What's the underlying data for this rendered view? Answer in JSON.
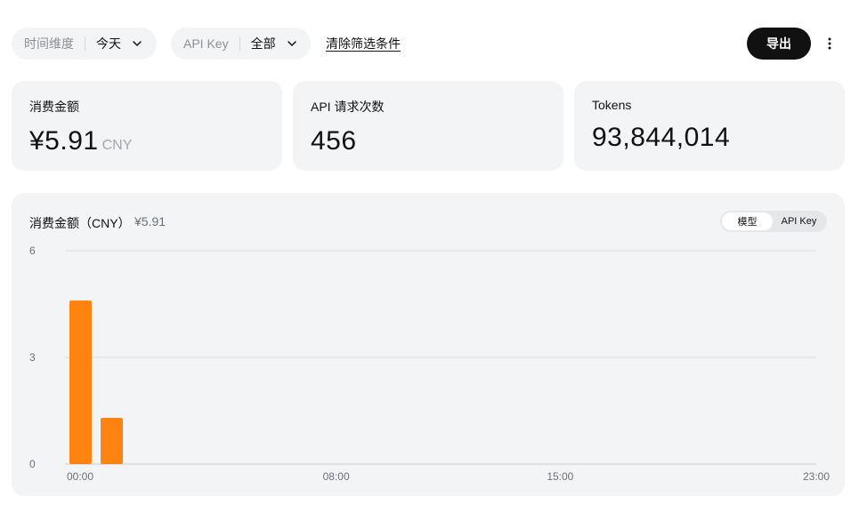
{
  "filters": {
    "time": {
      "label": "时间维度",
      "value": "今天"
    },
    "api_key": {
      "label": "API Key",
      "value": "全部"
    },
    "clear_label": "清除筛选条件"
  },
  "toolbar": {
    "export_label": "导出",
    "more_icon": "more-vertical-icon"
  },
  "cards": [
    {
      "title": "消费金额",
      "value": "¥5.91",
      "unit": "CNY"
    },
    {
      "title": "API 请求次数",
      "value": "456"
    },
    {
      "title": "Tokens",
      "value": "93,844,014"
    }
  ],
  "chart_panel": {
    "title": "消费金额（CNY）",
    "total": "¥5.91",
    "toggle": {
      "options": [
        "模型",
        "API Key"
      ],
      "active": "模型"
    }
  },
  "chart_data": {
    "type": "bar",
    "x": [
      "00:00",
      "01:00"
    ],
    "values": [
      4.6,
      1.3
    ],
    "x_ticks": [
      "00:00",
      "08:00",
      "15:00",
      "23:00"
    ],
    "y_ticks": [
      "0",
      "3",
      "6"
    ],
    "ylim": [
      0,
      6
    ],
    "x_range_hours": [
      0,
      23
    ],
    "color": "#ff8310",
    "grid": true
  }
}
